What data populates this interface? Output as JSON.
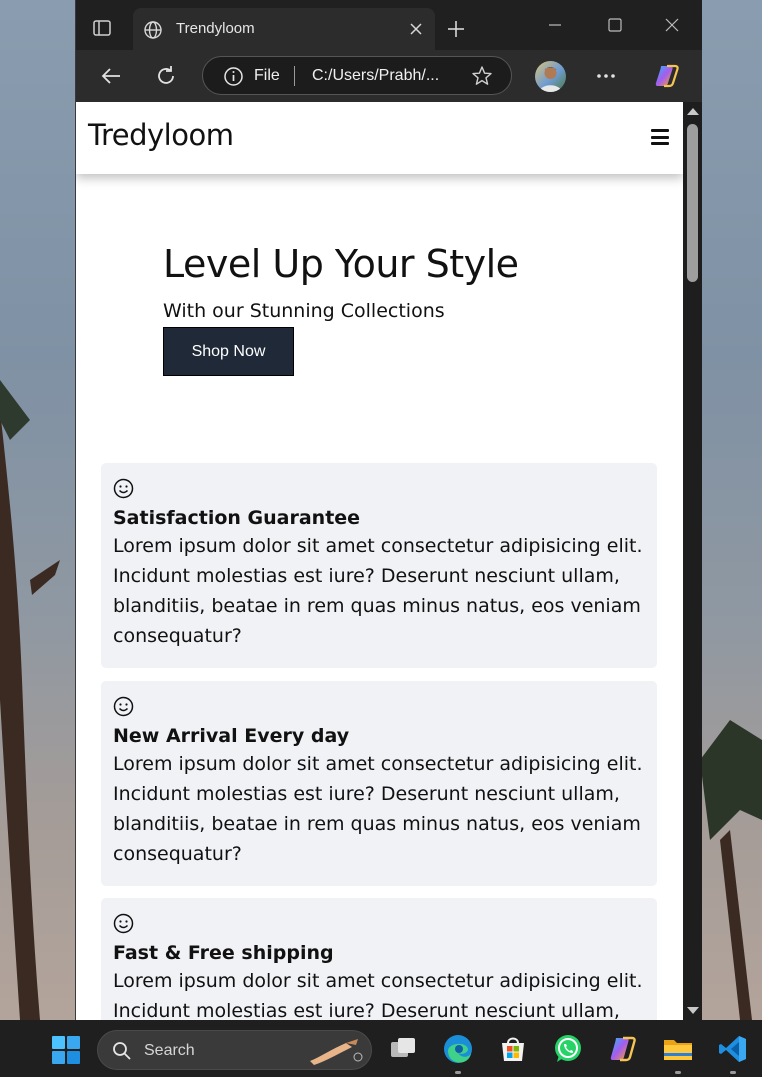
{
  "browser": {
    "tab_title": "Trendyloom",
    "address_scheme": "File",
    "address_url": "C:/Users/Prabh/..."
  },
  "page": {
    "brand": "Tredyloom",
    "hero": {
      "title": "Level Up Your Style",
      "subtitle": "With our Stunning Collections",
      "cta": "Shop Now"
    },
    "features": [
      {
        "icon": "smiley-icon",
        "title": "Satisfaction Guarantee",
        "text": "Lorem ipsum dolor sit amet consectetur adipisicing elit. Incidunt molestias est iure? Deserunt nesciunt ullam, blanditiis, beatae in rem quas minus natus, eos veniam consequatur?"
      },
      {
        "icon": "smiley-icon",
        "title": "New Arrival Every day",
        "text": "Lorem ipsum dolor sit amet consectetur adipisicing elit. Incidunt molestias est iure? Deserunt nesciunt ullam, blanditiis, beatae in rem quas minus natus, eos veniam consequatur?"
      },
      {
        "icon": "smiley-icon",
        "title": "Fast & Free shipping",
        "text": "Lorem ipsum dolor sit amet consectetur adipisicing elit. Incidunt molestias est iure? Deserunt nesciunt ullam, blanditiis, beatae in rem quas minus natus, eos veniam consequatur?"
      }
    ]
  },
  "taskbar": {
    "search_placeholder": "Search",
    "apps": [
      "task-view",
      "edge",
      "microsoft-store",
      "whatsapp",
      "copilot",
      "file-explorer",
      "vs-code"
    ]
  },
  "colors": {
    "cta_background": "#1f2937",
    "feature_card_background": "#f1f2f6",
    "browser_chrome": "#202020"
  }
}
